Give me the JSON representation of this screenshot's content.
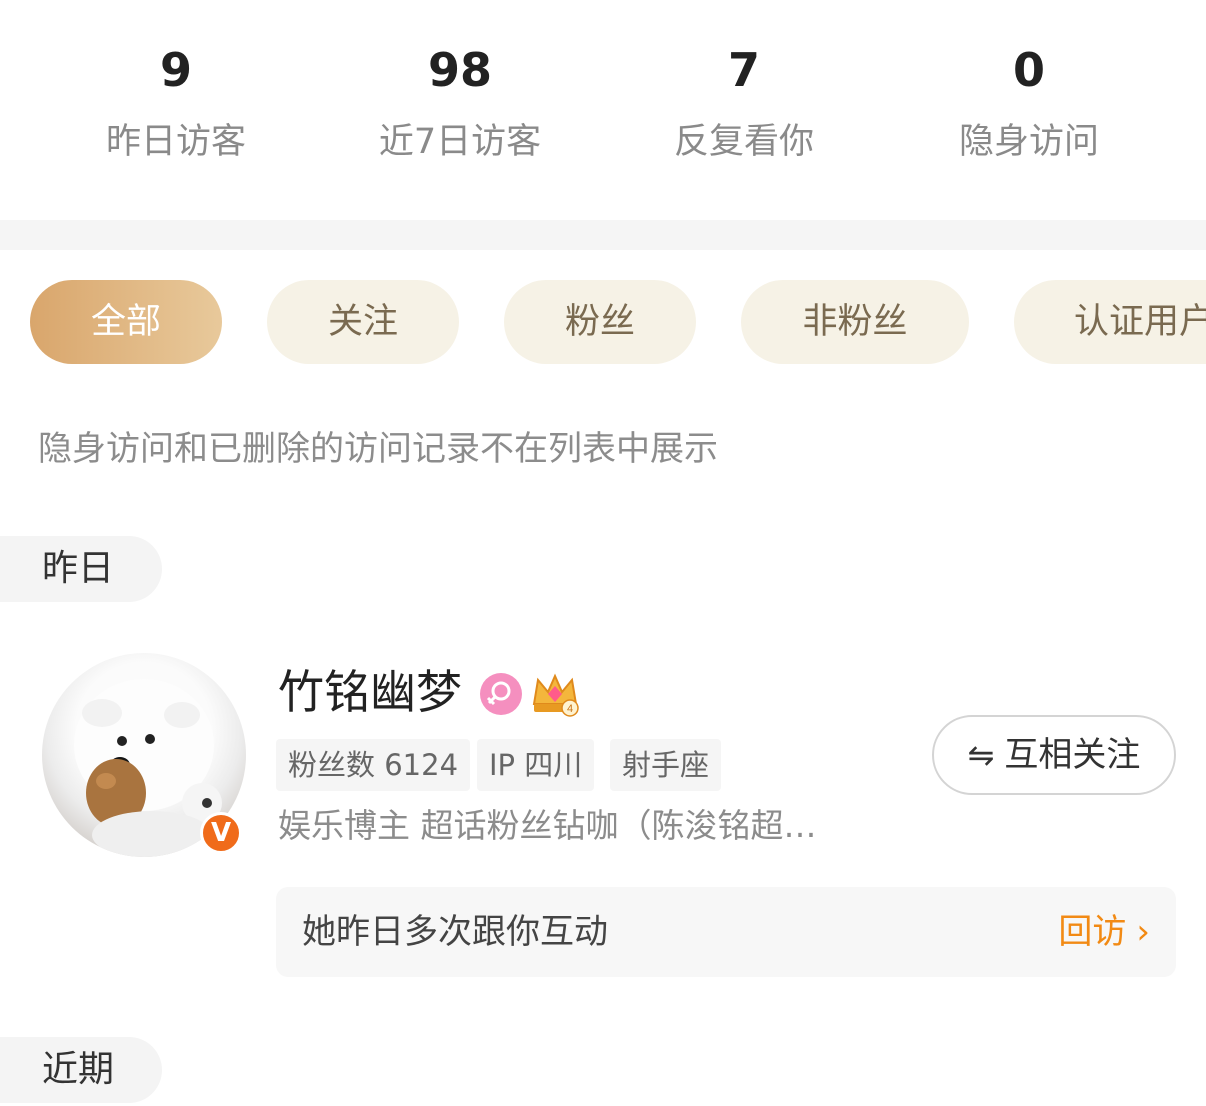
{
  "stats": [
    {
      "value": "9",
      "label": "昨日访客"
    },
    {
      "value": "98",
      "label": "近7日访客"
    },
    {
      "value": "7",
      "label": "反复看你"
    },
    {
      "value": "0",
      "label": "隐身访问"
    }
  ],
  "filters": [
    "全部",
    "关注",
    "粉丝",
    "非粉丝",
    "认证用户"
  ],
  "active_filter": "全部",
  "note": "隐身访问和已删除的访问记录不在列表中展示",
  "sections": {
    "yesterday": "昨日",
    "recent": "近期"
  },
  "visitor": {
    "name": "竹铭幽梦",
    "avatar_icon": "dog-avatar",
    "verified_badge": "V",
    "gender_icon": "female-icon",
    "vip_icon": "crown-icon",
    "vip_level": "4",
    "tags": [
      "粉丝数 6124",
      "IP 四川",
      "射手座"
    ],
    "bio": "娱乐博主 超话粉丝钻咖（陈浚铭超…",
    "follow_label": "互相关注",
    "follow_icon": "⇋",
    "interaction": "她昨日多次跟你互动",
    "revisit_label": "回访",
    "revisit_chevron": "›"
  },
  "colors": {
    "accent_orange": "#f28a14",
    "chip_active_start": "#d9a66c",
    "chip_bg": "#f6f2e6",
    "verified_orange": "#f06b1a",
    "female_pink": "#f58fbf"
  }
}
